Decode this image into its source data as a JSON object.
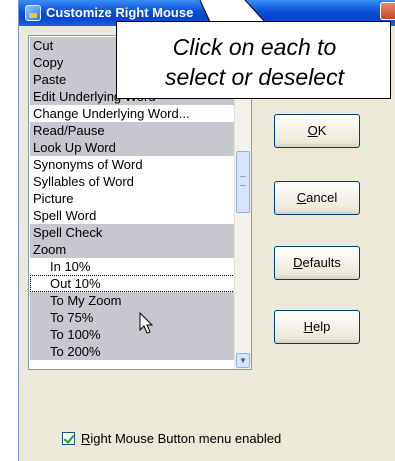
{
  "window": {
    "title": "Customize Right Mouse"
  },
  "list": {
    "items": [
      {
        "label": "Cut",
        "selected": true,
        "indent": false
      },
      {
        "label": "Copy",
        "selected": true,
        "indent": false
      },
      {
        "label": "Paste",
        "selected": true,
        "indent": false
      },
      {
        "label": "Edit Underlying Word",
        "selected": true,
        "indent": false
      },
      {
        "label": "Change Underlying Word...",
        "selected": false,
        "indent": false
      },
      {
        "label": "Read/Pause",
        "selected": true,
        "indent": false
      },
      {
        "label": "Look Up Word",
        "selected": true,
        "indent": false
      },
      {
        "label": "Synonyms of Word",
        "selected": false,
        "indent": false
      },
      {
        "label": "Syllables of Word",
        "selected": false,
        "indent": false
      },
      {
        "label": "Picture",
        "selected": false,
        "indent": false
      },
      {
        "label": "Spell Word",
        "selected": false,
        "indent": false
      },
      {
        "label": "Spell Check",
        "selected": true,
        "indent": false
      },
      {
        "label": "Zoom",
        "selected": true,
        "indent": false
      },
      {
        "label": "In 10%",
        "selected": false,
        "indent": true
      },
      {
        "label": "Out 10%",
        "selected": false,
        "indent": true,
        "focused": true
      },
      {
        "label": "To My Zoom",
        "selected": true,
        "indent": true
      },
      {
        "label": "To 75%",
        "selected": true,
        "indent": true
      },
      {
        "label": "To 100%",
        "selected": true,
        "indent": true
      },
      {
        "label": "To 200%",
        "selected": true,
        "indent": true
      }
    ]
  },
  "buttons": {
    "ok": {
      "mnemonic": "O",
      "rest": "K"
    },
    "cancel": {
      "mnemonic": "C",
      "rest": "ancel"
    },
    "defaults": {
      "mnemonic": "D",
      "rest": "efaults"
    },
    "help": {
      "mnemonic": "H",
      "rest": "elp"
    }
  },
  "checkbox": {
    "mnemonic": "R",
    "rest": "ight Mouse Button menu enabled",
    "checked": true
  },
  "callout": {
    "line1": "Click on each to",
    "line2": "select or deselect"
  },
  "colors": {
    "titlebar": "#0a4fd8",
    "selected_row": "#c7c7cf",
    "dialog_bg": "#ece9d8"
  }
}
